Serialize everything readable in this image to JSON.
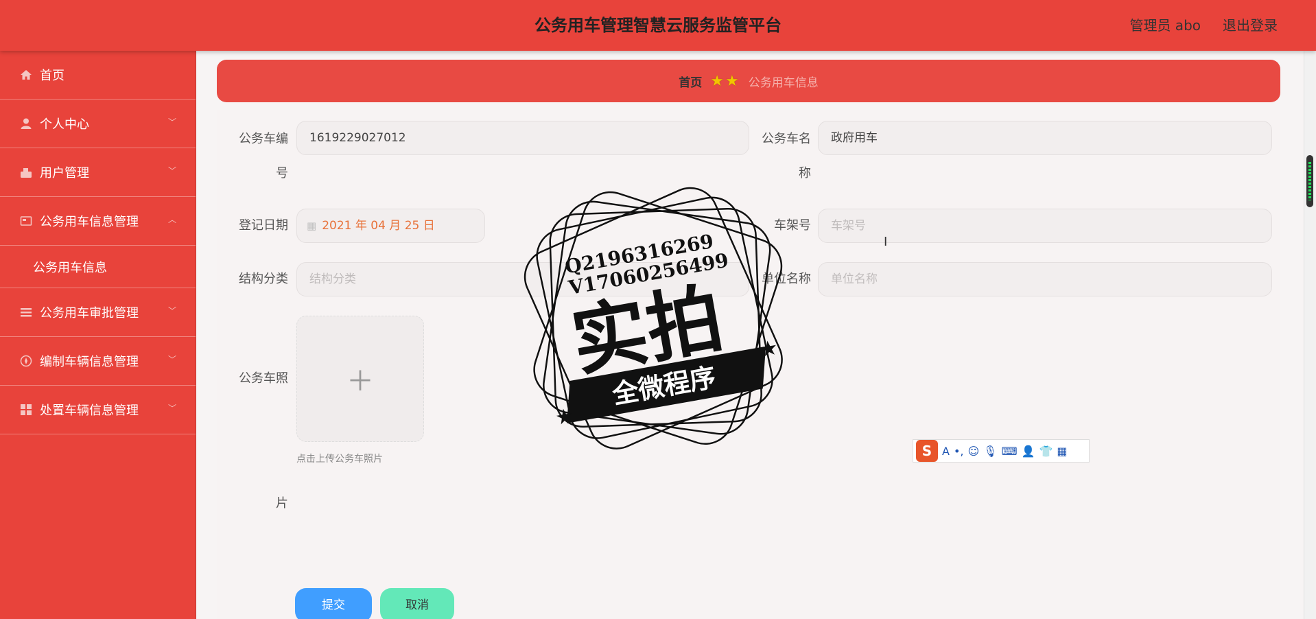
{
  "header": {
    "title": "公务用车管理智慧云服务监管平台",
    "user": "管理员 abo",
    "logout": "退出登录"
  },
  "sidebar": {
    "items": [
      {
        "label": "首页",
        "icon": "home-icon"
      },
      {
        "label": "个人中心",
        "icon": "user-icon"
      },
      {
        "label": "用户管理",
        "icon": "users-icon"
      },
      {
        "label": "公务用车信息管理",
        "icon": "card-icon"
      },
      {
        "label": "公务用车信息",
        "icon": ""
      },
      {
        "label": "公务用车审批管理",
        "icon": "list-icon"
      },
      {
        "label": "编制车辆信息管理",
        "icon": "compass-icon"
      },
      {
        "label": "处置车辆信息管理",
        "icon": "grid-icon"
      }
    ]
  },
  "breadcrumb": {
    "home": "首页",
    "current": "公务用车信息"
  },
  "form": {
    "car_no_label_1": "公务车编",
    "car_no_label_2": "号",
    "car_no_value": "1619229027012",
    "car_name_label_1": "公务车名",
    "car_name_label_2": "称",
    "car_name_value": "政府用车",
    "reg_date_label": "登记日期",
    "reg_date_value": "2021 年 04 月 25 日",
    "frame_label": "车架号",
    "frame_placeholder": "车架号",
    "struct_label": "结构分类",
    "struct_placeholder": "结构分类",
    "unit_label": "单位名称",
    "unit_placeholder": "单位名称",
    "photo_label_1": "公务车照",
    "photo_label_2": "片",
    "upload_hint": "点击上传公务车照片",
    "submit": "提交",
    "cancel": "取消"
  },
  "watermark": {
    "line1": "Q2196316269",
    "line2": "V17060256499",
    "big": "实拍",
    "banner": "全微程序"
  },
  "colors": {
    "primary": "#e8433b",
    "submit": "#409eff",
    "cancel": "#63e8b8"
  }
}
